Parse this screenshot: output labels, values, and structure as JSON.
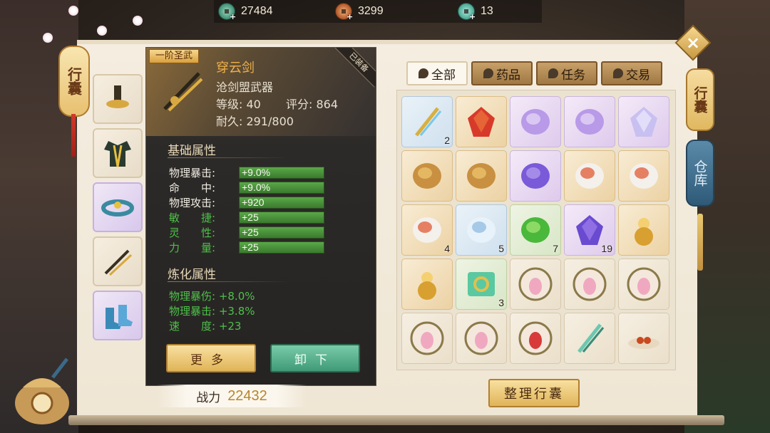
{
  "currencies": [
    {
      "icon": "jade-coin-icon",
      "value": "27484"
    },
    {
      "icon": "copper-coin-icon",
      "value": "3299"
    },
    {
      "icon": "teal-coin-icon",
      "value": "13"
    }
  ],
  "side_tabs": {
    "left_lantern": "行囊",
    "bag": "行囊",
    "warehouse": "仓库"
  },
  "tooltip": {
    "rank": "一阶圣武",
    "equipped": "已装备",
    "name": "穿云剑",
    "type": "沧剑盟武器",
    "level": "等级: 40",
    "score": "评分: 864",
    "durability": "耐久: 291/800",
    "base_title": "基础属性",
    "base_attrs": [
      {
        "label": "物理暴击:",
        "value": "+9.0%",
        "green": false
      },
      {
        "label": "命　　中:",
        "value": "+9.0%",
        "green": false
      },
      {
        "label": "物理攻击:",
        "value": "+920",
        "green": false
      },
      {
        "label": "敏　　捷:",
        "value": "+25",
        "green": true
      },
      {
        "label": "灵　　性:",
        "value": "+25",
        "green": true
      },
      {
        "label": "力　　量:",
        "value": "+25",
        "green": true
      }
    ],
    "refine_title": "炼化属性",
    "refine_attrs": [
      "物理暴伤: +8.0%",
      "物理暴击: +3.8%",
      "速　　度: +23"
    ],
    "more_button": "更多",
    "unequip_button": "卸下"
  },
  "power": {
    "label": "战力",
    "value": "22432"
  },
  "category_tabs": [
    "全部",
    "药品",
    "任务",
    "交易"
  ],
  "inventory": [
    {
      "icon": "sword-jade-icon",
      "count": "2",
      "bg": "blue"
    },
    {
      "icon": "red-gem-icon",
      "count": "",
      "bg": "gold"
    },
    {
      "icon": "purple-disc-icon",
      "count": "",
      "bg": "purple"
    },
    {
      "icon": "purple-disc-icon",
      "count": "",
      "bg": "purple"
    },
    {
      "icon": "crystal-shard-icon",
      "count": "",
      "bg": "purple"
    },
    {
      "icon": "gold-orb-icon",
      "count": "",
      "bg": "gold"
    },
    {
      "icon": "gold-orb-icon",
      "count": "",
      "bg": "gold"
    },
    {
      "icon": "purple-stone-icon",
      "count": "",
      "bg": "purple"
    },
    {
      "icon": "red-white-stone-icon",
      "count": "",
      "bg": "gold"
    },
    {
      "icon": "red-white-stone-icon",
      "count": "",
      "bg": "gold"
    },
    {
      "icon": "red-white-stone-icon",
      "count": "4",
      "bg": "gold"
    },
    {
      "icon": "blue-white-stone-icon",
      "count": "5",
      "bg": "blue"
    },
    {
      "icon": "green-orb-icon",
      "count": "7",
      "bg": "green"
    },
    {
      "icon": "purple-crystal-icon",
      "count": "19",
      "bg": "purple"
    },
    {
      "icon": "gold-gourd-icon",
      "count": "",
      "bg": "gold"
    },
    {
      "icon": "gold-gourd-icon",
      "count": "",
      "bg": "gold"
    },
    {
      "icon": "jade-ring-icon",
      "count": "3",
      "bg": "green"
    },
    {
      "icon": "lotus-medallion-icon",
      "count": "",
      "bg": "plain"
    },
    {
      "icon": "lotus-medallion-icon",
      "count": "",
      "bg": "plain"
    },
    {
      "icon": "lotus-medallion-icon",
      "count": "",
      "bg": "plain"
    },
    {
      "icon": "lotus-medallion-icon",
      "count": "",
      "bg": "plain"
    },
    {
      "icon": "lotus-medallion-icon",
      "count": "",
      "bg": "plain"
    },
    {
      "icon": "red-lotus-medallion-icon",
      "count": "",
      "bg": "plain"
    },
    {
      "icon": "jade-hook-icon",
      "count": "",
      "bg": "plain"
    },
    {
      "icon": "fruit-plate-icon",
      "count": "",
      "bg": "plain"
    }
  ],
  "sort_button": "整理行囊",
  "colors": {
    "accent_gold": "#e0b458",
    "item_name": "#f0b04a",
    "bonus_green": "#4ec04a",
    "unequip_teal": "#3f9a78"
  }
}
